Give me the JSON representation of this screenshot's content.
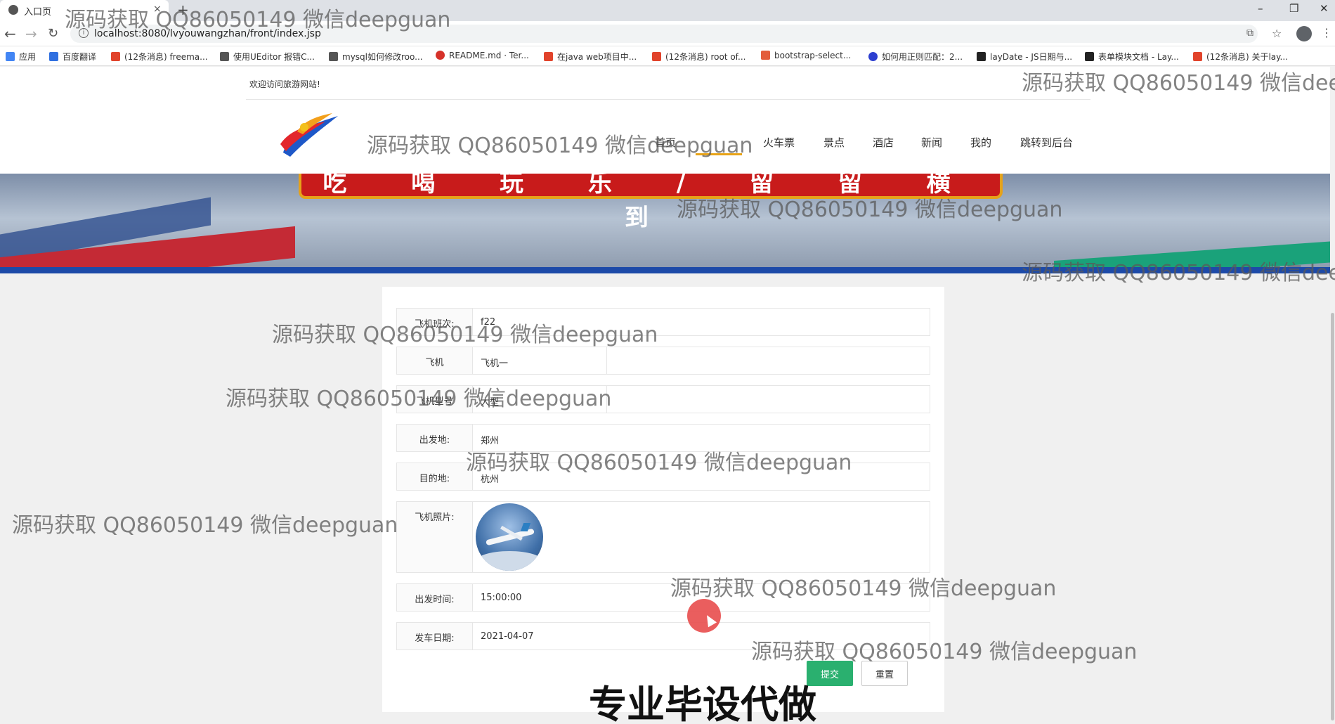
{
  "browser": {
    "tab_title": "入口页",
    "tab_close": "×",
    "new_tab": "+",
    "url": "localhost:8080/lvyouwangzhan/front/index.jsp",
    "window_controls": [
      "–",
      "❐",
      "✕"
    ],
    "bookmarks": [
      {
        "label": "应用",
        "color": "#4285f4"
      },
      {
        "label": "百度翻译",
        "color": "#2f6fe0"
      },
      {
        "label": "(12条消息) freema...",
        "color": "#e1432b"
      },
      {
        "label": "使用UEditor 报错C...",
        "color": "#555555"
      },
      {
        "label": "mysql如何修改roo...",
        "color": "#555555"
      },
      {
        "label": "README.md · Ter...",
        "color": "#d6322a"
      },
      {
        "label": "在java web项目中...",
        "color": "#e1432b"
      },
      {
        "label": "(12条消息) root of...",
        "color": "#e1432b"
      },
      {
        "label": "bootstrap-select...",
        "color": "#e35d3b"
      },
      {
        "label": "如何用正则匹配：2...",
        "color": "#2d3fd0"
      },
      {
        "label": "layDate - JS日期与...",
        "color": "#222222"
      },
      {
        "label": "表单模块文档 - Lay...",
        "color": "#222222"
      },
      {
        "label": "(12条消息) 关于lay...",
        "color": "#e1432b"
      }
    ]
  },
  "site": {
    "welcome": "欢迎访问旅游网站!",
    "nav": [
      "首页",
      "火车票",
      "景点",
      "酒店",
      "新闻",
      "我的",
      "跳转到后台"
    ],
    "banner_text": "吃 喝 玩 乐 / 留 留 横 到"
  },
  "form": {
    "rows": [
      {
        "label": "飞机班次:",
        "value": "f22"
      },
      {
        "label": "飞机",
        "value": "飞机一"
      },
      {
        "label": "飞机型号",
        "value": "大型"
      },
      {
        "label": "出发地:",
        "value": "郑州"
      },
      {
        "label": "目的地:",
        "value": "杭州"
      },
      {
        "label": "飞机照片:",
        "value": ""
      },
      {
        "label": "出发时间:",
        "value": "15:00:00"
      },
      {
        "label": "发车日期:",
        "value": "2021-04-07"
      }
    ],
    "submit": "提交",
    "reset": "重置"
  },
  "watermark": {
    "text": "源码获取 QQ86050149 微信deepguan",
    "text_clipped": "源码获取 QQ86050149 微信dee",
    "big": "专业毕设代做"
  },
  "colors": {
    "accent_underline": "#e8a317",
    "submit_green": "#2ab06f",
    "banner_red": "#c81b1b"
  }
}
